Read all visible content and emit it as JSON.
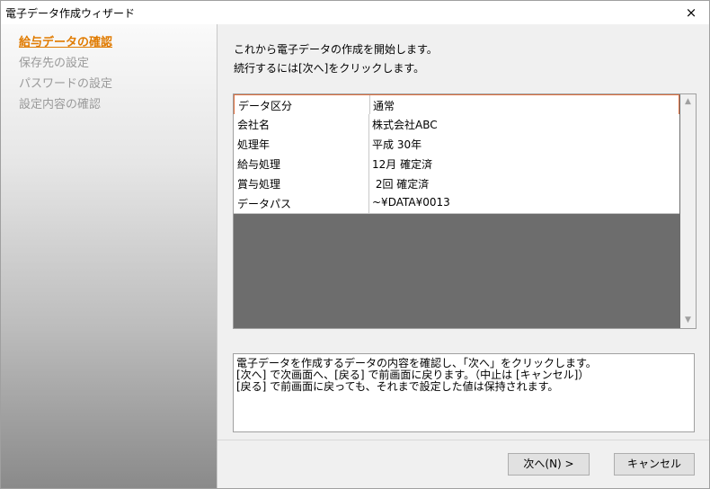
{
  "window": {
    "title": "電子データ作成ウィザード",
    "close_symbol": "×"
  },
  "sidebar": {
    "steps": [
      {
        "label": "給与データの確認",
        "active": true
      },
      {
        "label": "保存先の設定",
        "active": false
      },
      {
        "label": "パスワードの設定",
        "active": false
      },
      {
        "label": "設定内容の確認",
        "active": false
      }
    ]
  },
  "main": {
    "intro": [
      "これから電子データの作成を開始します。",
      "続行するには[次へ]をクリックします。"
    ],
    "grid": {
      "rows": [
        {
          "key": "データ区分",
          "value": "通常"
        },
        {
          "key": "会社名",
          "value": "株式会社ABC"
        },
        {
          "key": "処理年",
          "value": "平成 30年"
        },
        {
          "key": "給与処理",
          "value": "12月 確定済"
        },
        {
          "key": "賞与処理",
          "value": " 2回 確定済"
        },
        {
          "key": "データパス",
          "value": "~¥DATA¥0013"
        }
      ]
    },
    "description": [
      "電子データを作成するデータの内容を確認し、「次へ」をクリックします。",
      "[次へ] で次画面へ、[戻る] で前画面に戻ります。（中止は [キャンセル]）",
      "[戻る] で前画面に戻っても、それまで設定した値は保持されます。"
    ]
  },
  "buttons": {
    "next": "次へ(N) >",
    "cancel": "キャンセル"
  }
}
